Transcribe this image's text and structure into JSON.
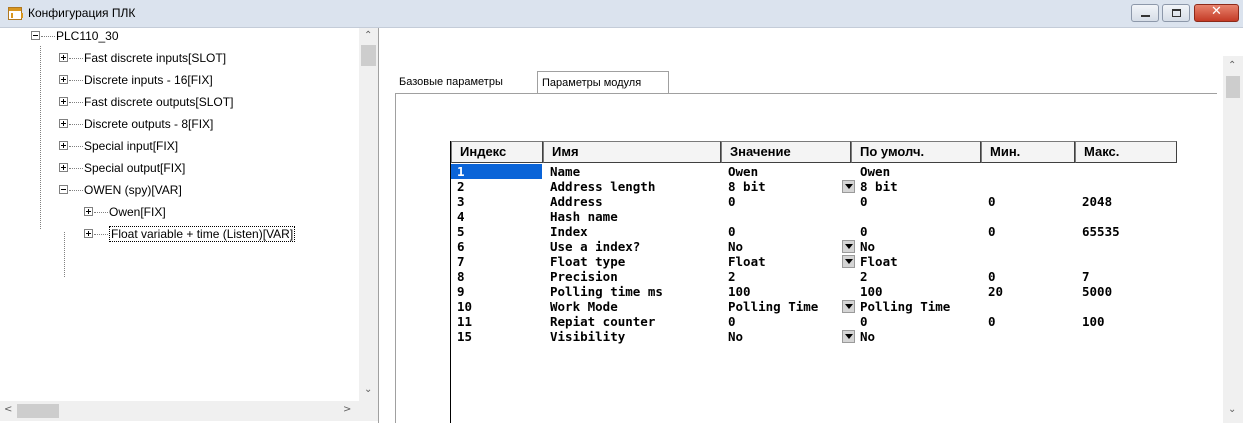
{
  "window": {
    "title": "Конфигурация ПЛК"
  },
  "tree": {
    "root": "PLC110_30",
    "children": [
      {
        "label": "Fast discrete inputs[SLOT]"
      },
      {
        "label": "Discrete inputs - 16[FIX]"
      },
      {
        "label": "Fast discrete outputs[SLOT]"
      },
      {
        "label": "Discrete outputs - 8[FIX]"
      },
      {
        "label": "Special input[FIX]"
      },
      {
        "label": "Special output[FIX]"
      },
      {
        "label": "OWEN (spy)[VAR]"
      }
    ],
    "owen_children": [
      {
        "label": "Owen[FIX]"
      },
      {
        "label": "Float variable + time (Listen)[VAR]"
      }
    ]
  },
  "tabs": {
    "base": "Базовые параметры",
    "module": "Параметры модуля"
  },
  "table": {
    "headers": {
      "index": "Индекс",
      "name": "Имя",
      "value": "Значение",
      "default": "По умолч.",
      "min": "Мин.",
      "max": "Макс."
    },
    "rows": [
      {
        "index": "1",
        "name": "Name",
        "value": "Owen",
        "default": "Owen",
        "min": "",
        "max": ""
      },
      {
        "index": "2",
        "name": "Address length",
        "value": "8 bit",
        "default": "8 bit",
        "min": "",
        "max": ""
      },
      {
        "index": "3",
        "name": "Address",
        "value": "0",
        "default": "0",
        "min": "0",
        "max": "2048"
      },
      {
        "index": "4",
        "name": "Hash name",
        "value": "",
        "default": "",
        "min": "",
        "max": ""
      },
      {
        "index": "5",
        "name": "Index",
        "value": "0",
        "default": "0",
        "min": "0",
        "max": "65535"
      },
      {
        "index": "6",
        "name": "Use a index?",
        "value": "No",
        "default": "No",
        "min": "",
        "max": ""
      },
      {
        "index": "7",
        "name": "Float type",
        "value": "Float",
        "default": "Float",
        "min": "",
        "max": ""
      },
      {
        "index": "8",
        "name": "Precision",
        "value": "2",
        "default": "2",
        "min": "0",
        "max": "7"
      },
      {
        "index": "9",
        "name": "Polling time ms",
        "value": "100",
        "default": "100",
        "min": "20",
        "max": "5000"
      },
      {
        "index": "10",
        "name": "Work Mode",
        "value": "Polling Time",
        "default": "Polling Time",
        "min": "",
        "max": ""
      },
      {
        "index": "11",
        "name": "Repiat counter",
        "value": "0",
        "default": "0",
        "min": "0",
        "max": "100"
      },
      {
        "index": "15",
        "name": "Visibility",
        "value": "No",
        "default": "No",
        "min": "",
        "max": ""
      }
    ]
  }
}
